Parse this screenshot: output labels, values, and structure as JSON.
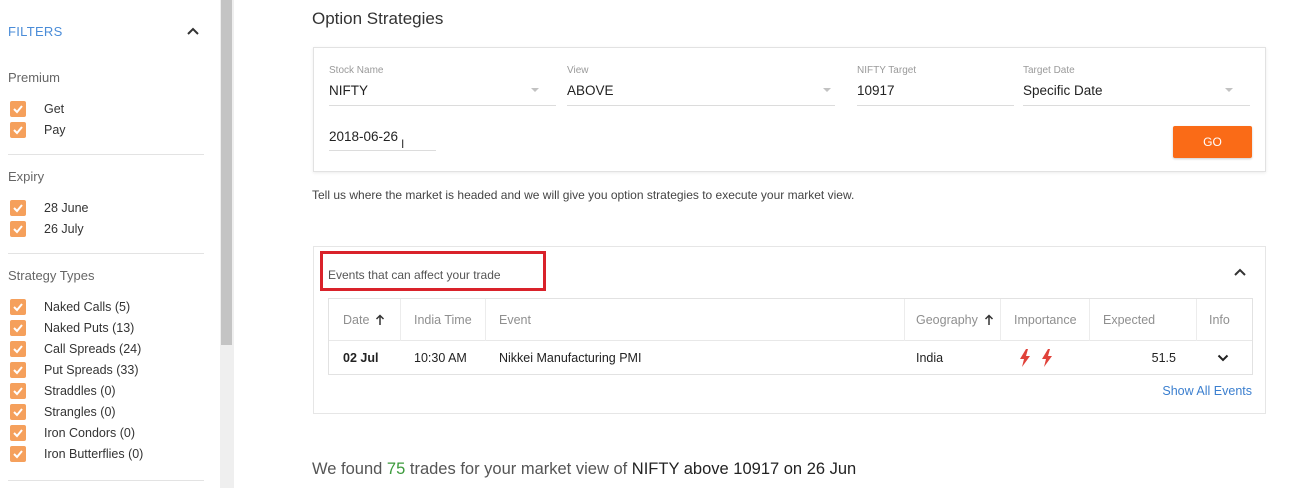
{
  "sidebar": {
    "title": "FILTERS",
    "sections": [
      {
        "title": "Premium",
        "items": [
          "Get",
          "Pay"
        ]
      },
      {
        "title": "Expiry",
        "items": [
          "28 June",
          "26 July"
        ]
      },
      {
        "title": "Strategy Types",
        "items": [
          "Naked Calls (5)",
          "Naked Puts (13)",
          "Call Spreads (24)",
          "Put Spreads (33)",
          "Straddles (0)",
          "Strangles (0)",
          "Iron Condors (0)",
          "Iron Butterflies (0)"
        ]
      }
    ]
  },
  "main": {
    "title": "Option Strategies",
    "form": {
      "stock_label": "Stock Name",
      "stock_value": "NIFTY",
      "view_label": "View",
      "view_value": "ABOVE",
      "target_label": "NIFTY Target",
      "target_value": "10917",
      "date_label": "Target Date",
      "date_value": "Specific Date",
      "specific_date": "2018-06-26",
      "go_label": "GO"
    },
    "help_text": "Tell us where the market is headed and we will give you option strategies to execute your market view.",
    "events": {
      "title": "Events that can affect your trade",
      "columns": [
        "Date",
        "India Time",
        "Event",
        "Geography",
        "Importance",
        "Expected",
        "Info"
      ],
      "rows": [
        {
          "date": "02 Jul",
          "time": "10:30 AM",
          "event": "Nikkei Manufacturing PMI",
          "geography": "India",
          "importance": 2,
          "expected": "51.5"
        }
      ],
      "show_all": "Show All Events"
    },
    "summary": {
      "prefix": "We found",
      "count": "75",
      "middle": "trades for your market view of",
      "view": "NIFTY above 10917 on 26 Jun"
    }
  },
  "colors": {
    "accent": "#fa6b17",
    "checkbox": "#f5a05c",
    "link": "#3b7fcf",
    "highlight_box": "#d9222a",
    "count": "#3c9a3c"
  }
}
